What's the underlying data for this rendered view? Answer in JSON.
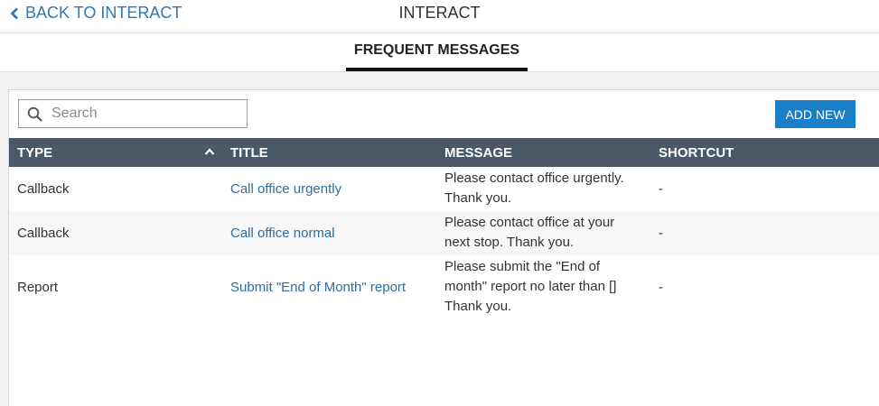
{
  "header": {
    "back_label": "BACK TO INTERACT",
    "title": "INTERACT"
  },
  "tabs": [
    {
      "label": "FREQUENT MESSAGES",
      "active": true
    }
  ],
  "toolbar": {
    "search_placeholder": "Search",
    "search_value": "",
    "add_new_label": "ADD NEW"
  },
  "table": {
    "columns": [
      "TYPE",
      "TITLE",
      "MESSAGE",
      "SHORTCUT"
    ],
    "sort": {
      "column": "TYPE",
      "direction": "ascending"
    },
    "rows": [
      {
        "type": "Callback",
        "title": "Call office urgently",
        "message": [
          "Please contact office urgently.",
          "Thank you."
        ],
        "shortcut": "-"
      },
      {
        "type": "Callback",
        "title": "Call office normal",
        "message": [
          "Please contact office at your",
          "next stop. Thank you."
        ],
        "shortcut": "-"
      },
      {
        "type": "Report",
        "title": "Submit \"End of Month\" report",
        "message": [
          "Please submit the \"End of",
          "month\" report no later than []",
          "Thank you."
        ],
        "shortcut": "-"
      }
    ]
  },
  "colors": {
    "link": "#2e78b6",
    "accent_button": "#1a7fc6",
    "table_header": "#4b5866",
    "active_tab_underline": "#111111"
  },
  "icons": {
    "back": "chevron-left-icon",
    "search": "search-icon",
    "sort": "chevron-up-icon"
  }
}
